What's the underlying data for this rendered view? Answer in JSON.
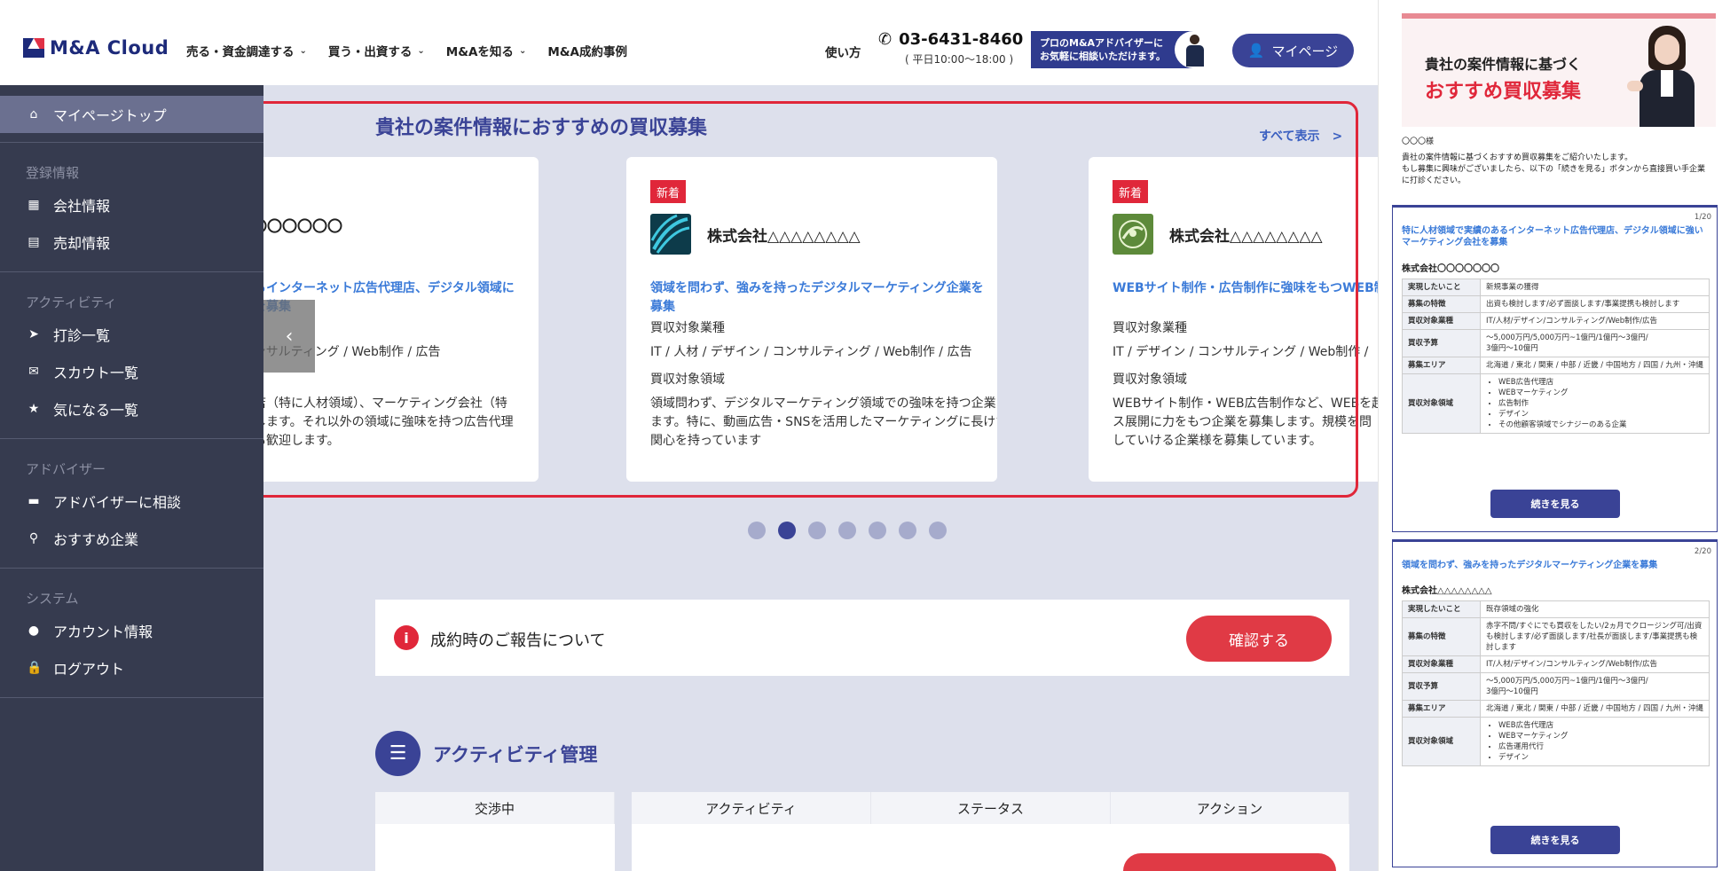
{
  "header": {
    "logo_text": "M&A Cloud",
    "nav": [
      {
        "label": "売る・資金調達する",
        "has_dropdown": true
      },
      {
        "label": "買う・出資する",
        "has_dropdown": true
      },
      {
        "label": "M&Aを知る",
        "has_dropdown": true
      },
      {
        "label": "M&A成約事例",
        "has_dropdown": false
      }
    ],
    "howto": "使い方",
    "phone": "03-6431-8460",
    "phone_hours": "( 平日10:00～18:00 )",
    "advisor_line1": "プロのM&Aアドバイザーに",
    "advisor_line2": "お気軽に相談いただけます。",
    "mypage": "マイページ"
  },
  "sidebar": {
    "top_label": "マイページトップ",
    "sections": [
      {
        "title": "登録情報",
        "items": [
          {
            "label": "会社情報",
            "icon": "building-icon"
          },
          {
            "label": "売却情報",
            "icon": "clipboard-icon"
          }
        ]
      },
      {
        "title": "アクティビティ",
        "items": [
          {
            "label": "打診一覧",
            "icon": "send-icon"
          },
          {
            "label": "スカウト一覧",
            "icon": "mail-icon"
          },
          {
            "label": "気になる一覧",
            "icon": "star-icon"
          }
        ]
      },
      {
        "title": "アドバイザー",
        "items": [
          {
            "label": "アドバイザーに相談",
            "icon": "chat-icon"
          },
          {
            "label": "おすすめ企業",
            "icon": "search-icon"
          }
        ]
      },
      {
        "title": "システム",
        "items": [
          {
            "label": "アカウント情報",
            "icon": "person-icon"
          },
          {
            "label": "ログアウト",
            "icon": "lock-icon"
          }
        ]
      }
    ]
  },
  "carousel": {
    "title": "貴社の案件情報におすすめの買収募集",
    "view_all": "すべて表示　>",
    "cards": [
      {
        "badge": "",
        "company": "式会社〇〇〇〇〇〇〇",
        "title": "で実績のあるインターネット広告代理店、デジタル領域に\nィング会社を募集",
        "industry_label": "",
        "industry": "ザイン / コンサルティング / Web制作 / 広告",
        "area_label": "",
        "area": "ト広告代理店（特に人材領域）、マーケティング会社（特\n域）を募集します。それ以外の領域に強味を持つ広告代理\nィング会社も歓迎します。"
      },
      {
        "badge": "新着",
        "company": "株式会社△△△△△△△△",
        "title": "領域を問わず、強みを持ったデジタルマーケティング企業を募集",
        "industry_label": "買収対象業種",
        "industry": "IT / 人材 / デザイン / コンサルティング / Web制作 / 広告",
        "area_label": "買収対象領域",
        "area": "領域問わず、デジタルマーケティング領域での強味を持つ企業を募集し\nます。特に、動画広告・SNSを活用したマーケティングに長けた企業に\n関心を持っています"
      },
      {
        "badge": "新着",
        "company": "株式会社△△△△△△△△",
        "title": "WEBサイト制作・広告制作に強味をもつWEB制",
        "industry_label": "買収対象業種",
        "industry": "IT / デザイン / コンサルティング / Web制作 /",
        "area_label": "買収対象領域",
        "area": "WEBサイト制作・WEB広告制作など、WEBを起\nス展開に力をもつ企業を募集します。規模を問\nしていける企業様を募集しています。"
      }
    ],
    "dots_total": 7,
    "dots_active": 2
  },
  "notice": {
    "text": "成約時のご報告について",
    "button": "確認する"
  },
  "activity": {
    "title": "アクティビティ管理",
    "col_negotiating": "交渉中",
    "columns": [
      "アクティビティ",
      "ステータス",
      "アクション"
    ]
  },
  "email": {
    "banner_sub": "貴社の案件情報に基づく",
    "banner_main": "おすすめ買収募集",
    "greeting": "〇〇〇様",
    "intro": "貴社の案件情報に基づくおすすめ買収募集をご紹介いたします。\nもし募集に興味がございましたら、以下の「続きを見る」ボタンから直接買い手企業\nに打診ください。",
    "cards": [
      {
        "count": "1/20",
        "title": "特に人材領域で実績のあるインターネット広告代理店、デジタル領域に強いマーケティング会社を募集",
        "company": "株式会社〇〇〇〇〇〇〇",
        "rows": [
          {
            "k": "実現したいこと",
            "v": "新規事業の獲得"
          },
          {
            "k": "募集の特徴",
            "v": "出資も検討します/必ず面談します/事業提携も検討します"
          },
          {
            "k": "買収対象業種",
            "v": "IT/人材/デザイン/コンサルティング/Web制作/広告"
          },
          {
            "k": "買収予算",
            "v": "〜5,000万円/5,000万円~1億円/1億円〜3億円/\n3億円〜10億円"
          },
          {
            "k": "募集エリア",
            "v": "北海道 / 東北 / 関東 / 中部 / 近畿 / 中国地方 / 四国 / 九州・沖縄"
          }
        ],
        "list_key": "買収対象領域",
        "list": [
          "WEB広告代理店",
          "WEBマーケティング",
          "広告制作",
          "デザイン",
          "その他顧客領域でシナジーのある企業"
        ],
        "button": "続きを見る"
      },
      {
        "count": "2/20",
        "title": "領域を問わず、強みを持ったデジタルマーケティング企業を募集",
        "company": "株式会社△△△△△△△△",
        "rows": [
          {
            "k": "実現したいこと",
            "v": "既存領域の強化"
          },
          {
            "k": "募集の特徴",
            "v": "赤字不問/すぐにでも買収をしたい/2ヵ月でクロージング可/出資も検討します/必ず面談します/社長が面談します/事業提携も検討します"
          },
          {
            "k": "買収対象業種",
            "v": "IT/人材/デザイン/コンサルティング/Web制作/広告"
          },
          {
            "k": "買収予算",
            "v": "〜5,000万円/5,000万円~1億円/1億円〜3億円/\n3億円〜10億円"
          },
          {
            "k": "募集エリア",
            "v": "北海道 / 東北 / 関東 / 中部 / 近畿 / 中国地方 / 四国 / 九州・沖縄"
          }
        ],
        "list_key": "買収対象領域",
        "list": [
          "WEB広告代理店",
          "WEBマーケティング",
          "広告運用代行",
          "デザイン"
        ],
        "button": "続きを見る"
      }
    ]
  },
  "colors": {
    "brand_navy": "#3a4396",
    "accent_red": "#e0273a",
    "sidebar_bg": "#363b4f",
    "main_bg": "#dde0ec",
    "link_blue": "#3a7ad8"
  }
}
